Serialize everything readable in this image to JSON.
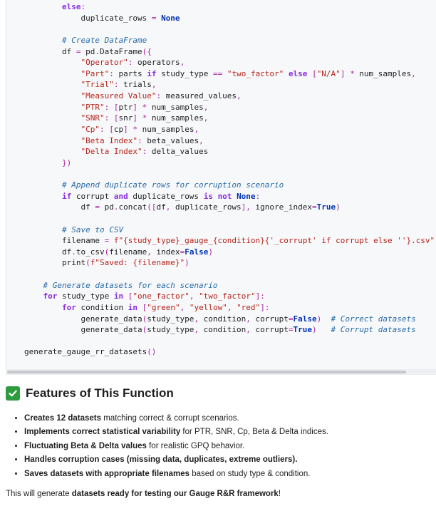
{
  "code": {
    "lines": [
      "        else:",
      "            duplicate_rows = None",
      "",
      "        # Create DataFrame",
      "        df = pd.DataFrame({",
      "            \"Operator\": operators,",
      "            \"Part\": parts if study_type == \"two_factor\" else [\"N/A\"] * num_samples,",
      "            \"Trial\": trials,",
      "            \"Measured Value\": measured_values,",
      "            \"PTR\": [ptr] * num_samples,",
      "            \"SNR\": [snr] * num_samples,",
      "            \"Cp\": [cp] * num_samples,",
      "            \"Beta Index\": beta_values,",
      "            \"Delta Index\": delta_values",
      "        })",
      "",
      "        # Append duplicate rows for corruption scenario",
      "        if corrupt and duplicate_rows is not None:",
      "            df = pd.concat([df, duplicate_rows], ignore_index=True)",
      "",
      "        # Save to CSV",
      "        filename = f\"{study_type}_gauge_{condition}{'_corrupt' if corrupt else ''}.csv\"",
      "        df.to_csv(filename, index=False)",
      "        print(f\"Saved: {filename}\")",
      "",
      "    # Generate datasets for each scenario",
      "    for study_type in [\"one_factor\", \"two_factor\"]:",
      "        for condition in [\"green\", \"yellow\", \"red\"]:",
      "            generate_data(study_type, condition, corrupt=False)  # Correct datasets",
      "            generate_data(study_type, condition, corrupt=True)   # Corrupt datasets",
      "",
      "generate_gauge_rr_datasets()"
    ]
  },
  "features": {
    "icon": "check-mark-icon",
    "icon_color": "#2e9b3f",
    "heading": "Features of This Function",
    "items": [
      {
        "bold": "Creates 12 datasets",
        "rest": " matching correct & corrupt scenarios."
      },
      {
        "bold": "Implements correct statistical variability",
        "rest": " for PTR, SNR, Cp, Beta & Delta indices."
      },
      {
        "bold": "Fluctuating Beta & Delta values",
        "rest": " for realistic GPQ behavior."
      },
      {
        "bold": "Handles corruption cases (missing data, duplicates, extreme outliers).",
        "rest": ""
      },
      {
        "bold": "Saves datasets with appropriate filenames",
        "rest": " based on study type & condition."
      }
    ]
  },
  "closing": {
    "prefix": "This will generate ",
    "bold": "datasets ready for testing our Gauge R&R framework",
    "suffix": "!"
  }
}
